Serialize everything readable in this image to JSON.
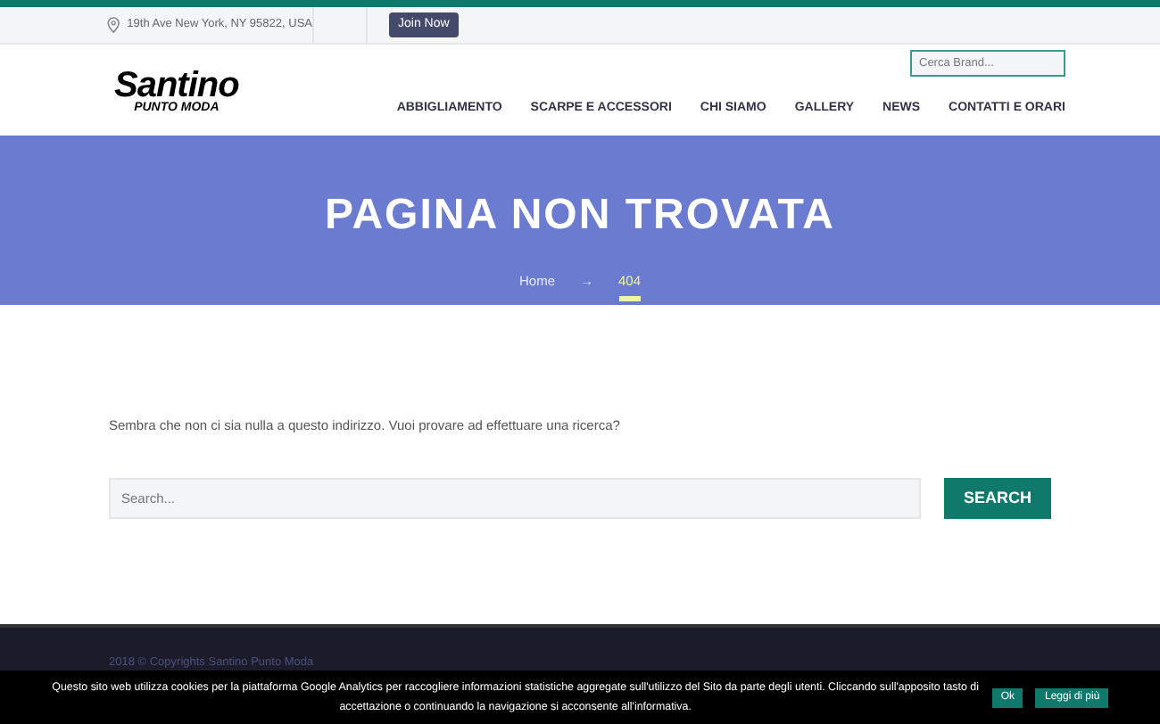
{
  "topbar": {
    "address": "19th Ave New York, NY 95822, USA",
    "join_button": "Join Now"
  },
  "header": {
    "logo": {
      "title": "Santino",
      "subtitle": "PUNTO MODA"
    },
    "brand_search": {
      "placeholder": "Cerca Brand..."
    },
    "nav": [
      {
        "label": "ABBIGLIAMENTO"
      },
      {
        "label": "SCARPE E ACCESSORI"
      },
      {
        "label": "CHI SIAMO"
      },
      {
        "label": "GALLERY"
      },
      {
        "label": "NEWS"
      },
      {
        "label": "CONTATTI E ORARI"
      }
    ]
  },
  "hero": {
    "title": "PAGINA NON TROVATA",
    "breadcrumb": [
      {
        "label": "Home",
        "selected": false
      },
      {
        "label": "→",
        "kind": "separator"
      },
      {
        "label": "404",
        "selected": true
      }
    ]
  },
  "content": {
    "message": "Sembra che non ci sia nulla a questo indirizzo. Vuoi provare ad effettuare una ricerca?",
    "search": {
      "placeholder": "Search...",
      "button": "SEARCH"
    }
  },
  "footer": {
    "copyright": "2018 © Copyrights Santino Punto Moda"
  },
  "cookie_bar": {
    "text": "Questo sito web utilizza cookies per la piattaforma Google Analytics per raccogliere informazioni statistiche aggregate sull'utilizzo del Sito da parte degli utenti. Cliccando sull'apposito tasto di accettazione o continuando la navigazione si acconsente all'informativa.",
    "buttons": [
      "Ok",
      "Leggi di più"
    ]
  }
}
